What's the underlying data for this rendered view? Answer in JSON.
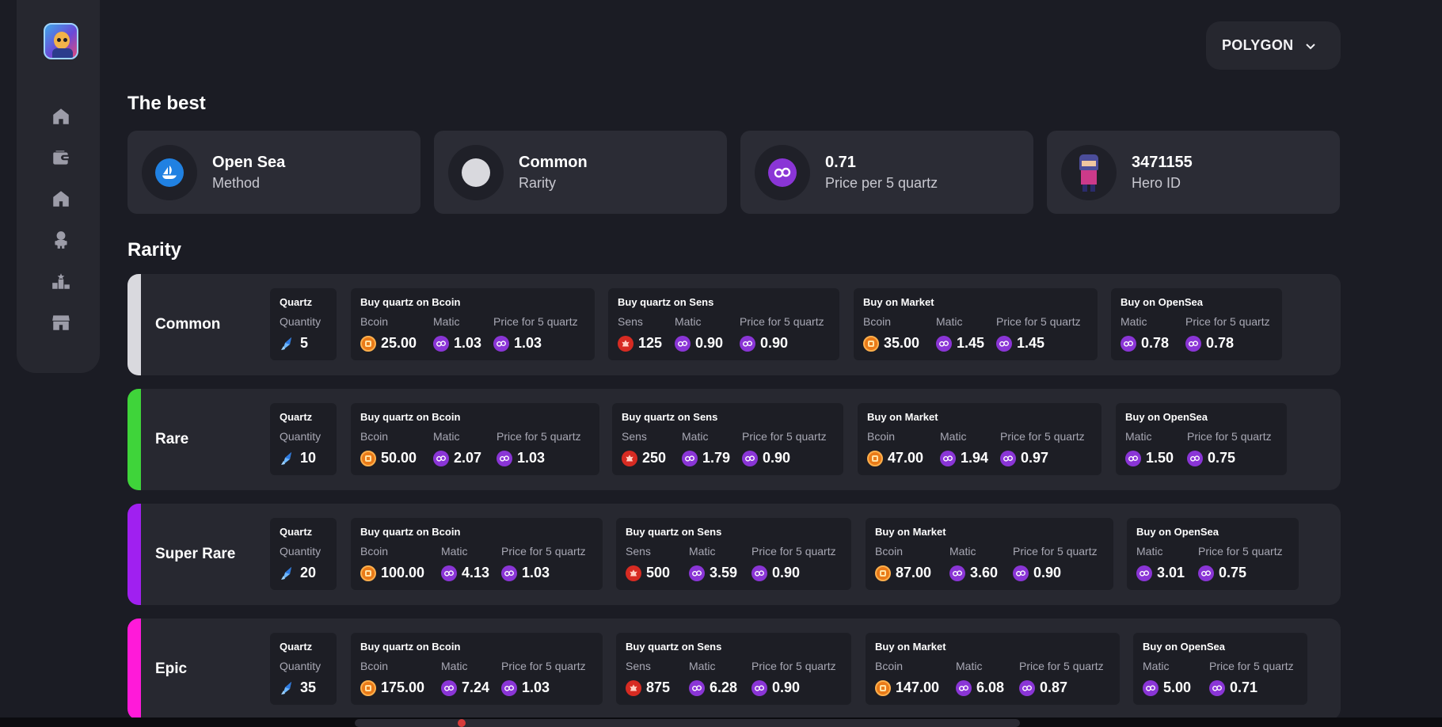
{
  "app": {
    "logo": "bomber-hero-logo"
  },
  "sidebar": {
    "items": [
      {
        "icon": "home-icon"
      },
      {
        "icon": "wallet-icon"
      },
      {
        "icon": "house-icon"
      },
      {
        "icon": "hero-icon"
      },
      {
        "icon": "leaderboard-icon"
      },
      {
        "icon": "shop-icon"
      }
    ]
  },
  "network": {
    "label": "POLYGON",
    "icon": "chevron-down-icon"
  },
  "best": {
    "heading": "The best",
    "cards": [
      {
        "value": "Open Sea",
        "label": "Method",
        "icon": "opensea-icon"
      },
      {
        "value": "Common",
        "label": "Rarity",
        "icon": "rarity-dot-icon"
      },
      {
        "value": "0.71",
        "label": "Price per 5 quartz",
        "icon": "matic-icon"
      },
      {
        "value": "3471155",
        "label": "Hero ID",
        "icon": "hero-avatar-icon"
      }
    ]
  },
  "rarity": {
    "heading": "Rarity",
    "colors": {
      "common": "#d9d9de",
      "rare": "#3fd43a",
      "super_rare": "#a020f0",
      "epic": "#ff1ad9"
    },
    "rows": [
      {
        "name": "Common",
        "quartz": {
          "title": "Quartz",
          "label": "Quantity",
          "value": "5"
        },
        "bcoin": {
          "title": "Buy quartz on Bcoin",
          "labels": [
            "Bcoin",
            "Matic",
            "Price for 5 quartz"
          ],
          "values": [
            "25.00",
            "1.03",
            "1.03"
          ]
        },
        "sens": {
          "title": "Buy quartz on Sens",
          "labels": [
            "Sens",
            "Matic",
            "Price for 5 quartz"
          ],
          "values": [
            "125",
            "0.90",
            "0.90"
          ]
        },
        "market": {
          "title": "Buy on Market",
          "labels": [
            "Bcoin",
            "Matic",
            "Price for 5 quartz"
          ],
          "values": [
            "35.00",
            "1.45",
            "1.45"
          ]
        },
        "opensea": {
          "title": "Buy on OpenSea",
          "labels": [
            "Matic",
            "Price for 5 quartz"
          ],
          "values": [
            "0.78",
            "0.78"
          ]
        }
      },
      {
        "name": "Rare",
        "quartz": {
          "title": "Quartz",
          "label": "Quantity",
          "value": "10"
        },
        "bcoin": {
          "title": "Buy quartz on Bcoin",
          "labels": [
            "Bcoin",
            "Matic",
            "Price for 5 quartz"
          ],
          "values": [
            "50.00",
            "2.07",
            "1.03"
          ]
        },
        "sens": {
          "title": "Buy quartz on Sens",
          "labels": [
            "Sens",
            "Matic",
            "Price for 5 quartz"
          ],
          "values": [
            "250",
            "1.79",
            "0.90"
          ]
        },
        "market": {
          "title": "Buy on Market",
          "labels": [
            "Bcoin",
            "Matic",
            "Price for 5 quartz"
          ],
          "values": [
            "47.00",
            "1.94",
            "0.97"
          ]
        },
        "opensea": {
          "title": "Buy on OpenSea",
          "labels": [
            "Matic",
            "Price for 5 quartz"
          ],
          "values": [
            "1.50",
            "0.75"
          ]
        }
      },
      {
        "name": "Super Rare",
        "quartz": {
          "title": "Quartz",
          "label": "Quantity",
          "value": "20"
        },
        "bcoin": {
          "title": "Buy quartz on Bcoin",
          "labels": [
            "Bcoin",
            "Matic",
            "Price for 5 quartz"
          ],
          "values": [
            "100.00",
            "4.13",
            "1.03"
          ]
        },
        "sens": {
          "title": "Buy quartz on Sens",
          "labels": [
            "Sens",
            "Matic",
            "Price for 5 quartz"
          ],
          "values": [
            "500",
            "3.59",
            "0.90"
          ]
        },
        "market": {
          "title": "Buy on Market",
          "labels": [
            "Bcoin",
            "Matic",
            "Price for 5 quartz"
          ],
          "values": [
            "87.00",
            "3.60",
            "0.90"
          ]
        },
        "opensea": {
          "title": "Buy on OpenSea",
          "labels": [
            "Matic",
            "Price for 5 quartz"
          ],
          "values": [
            "3.01",
            "0.75"
          ]
        }
      },
      {
        "name": "Epic",
        "quartz": {
          "title": "Quartz",
          "label": "Quantity",
          "value": "35"
        },
        "bcoin": {
          "title": "Buy quartz on Bcoin",
          "labels": [
            "Bcoin",
            "Matic",
            "Price for 5 quartz"
          ],
          "values": [
            "175.00",
            "7.24",
            "1.03"
          ]
        },
        "sens": {
          "title": "Buy quartz on Sens",
          "labels": [
            "Sens",
            "Matic",
            "Price for 5 quartz"
          ],
          "values": [
            "875",
            "6.28",
            "0.90"
          ]
        },
        "market": {
          "title": "Buy on Market",
          "labels": [
            "Bcoin",
            "Matic",
            "Price for 5 quartz"
          ],
          "values": [
            "147.00",
            "6.08",
            "0.87"
          ]
        },
        "opensea": {
          "title": "Buy on OpenSea",
          "labels": [
            "Matic",
            "Price for 5 quartz"
          ],
          "values": [
            "5.00",
            "0.71"
          ]
        }
      }
    ]
  }
}
